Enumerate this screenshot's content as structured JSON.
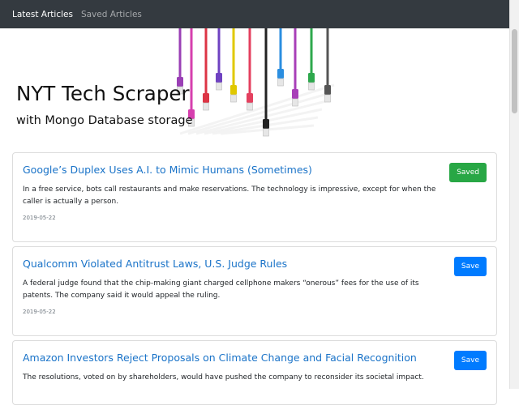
{
  "navbar": {
    "links": [
      {
        "label": "Latest Articles",
        "active": true
      },
      {
        "label": "Saved Articles",
        "active": false
      }
    ]
  },
  "hero": {
    "title": "NYT Tech Scraper",
    "subtitle": "with Mongo Database storage",
    "image_icon": "ethernet-cables-image"
  },
  "articles": [
    {
      "title": "Google’s Duplex Uses A.I. to Mimic Humans (Sometimes)",
      "summary": "In a free service, bots call restaurants and make reservations. The technology is impressive, except for when the caller is actually a person.",
      "date": "2019-05-22",
      "button": "Saved",
      "saved": true
    },
    {
      "title": "Qualcomm Violated Antitrust Laws, U.S. Judge Rules",
      "summary": "A federal judge found that the chip-making giant charged cellphone makers “onerous” fees for the use of its patents. The company said it would appeal the ruling.",
      "date": "2019-05-22",
      "button": "Save",
      "saved": false
    },
    {
      "title": "Amazon Investors Reject Proposals on Climate Change and Facial Recognition",
      "summary": "The resolutions, voted on by shareholders, would have pushed the company to reconsider its societal impact.",
      "date": "",
      "button": "Save",
      "saved": false
    }
  ],
  "colors": {
    "navbar_bg": "#343a40",
    "link": "#1a73c8",
    "saved_button": "#28a745",
    "save_button": "#007bff"
  }
}
